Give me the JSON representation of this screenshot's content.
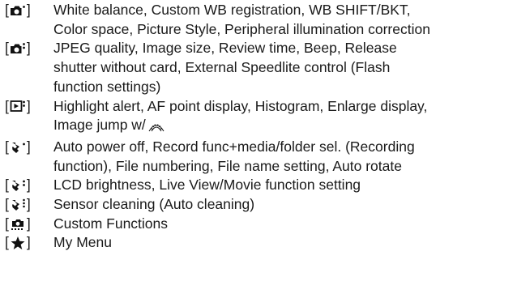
{
  "brackets": {
    "open": "[",
    "close": "]"
  },
  "entries": [
    {
      "icon": "camera-shooting-1-icon",
      "text": "White balance, Custom WB registration, WB SHIFT/BKT,\nColor space, Picture Style, Peripheral illumination correction"
    },
    {
      "icon": "camera-shooting-2-icon",
      "text": "JPEG quality, Image size, Review time, Beep, Release\nshutter without card, External Speedlite control (Flash\nfunction settings)"
    },
    {
      "icon": "playback-2-icon",
      "text": "Highlight alert, AF point display, Histogram, Enlarge display,\nImage jump w/"
    },
    {
      "icon": "setup-1-icon",
      "text": "Auto power off, Record func+media/folder sel. (Recording\nfunction), File numbering, File name setting, Auto rotate"
    },
    {
      "icon": "setup-2-icon",
      "text": "LCD brightness, Live View/Movie function setting"
    },
    {
      "icon": "setup-3-icon",
      "text": "Sensor cleaning (Auto cleaning)"
    },
    {
      "icon": "custom-functions-icon",
      "text": "Custom Functions"
    },
    {
      "icon": "star-icon",
      "text": "My Menu"
    }
  ],
  "inline_icons": {
    "dial": "main-dial-icon"
  }
}
